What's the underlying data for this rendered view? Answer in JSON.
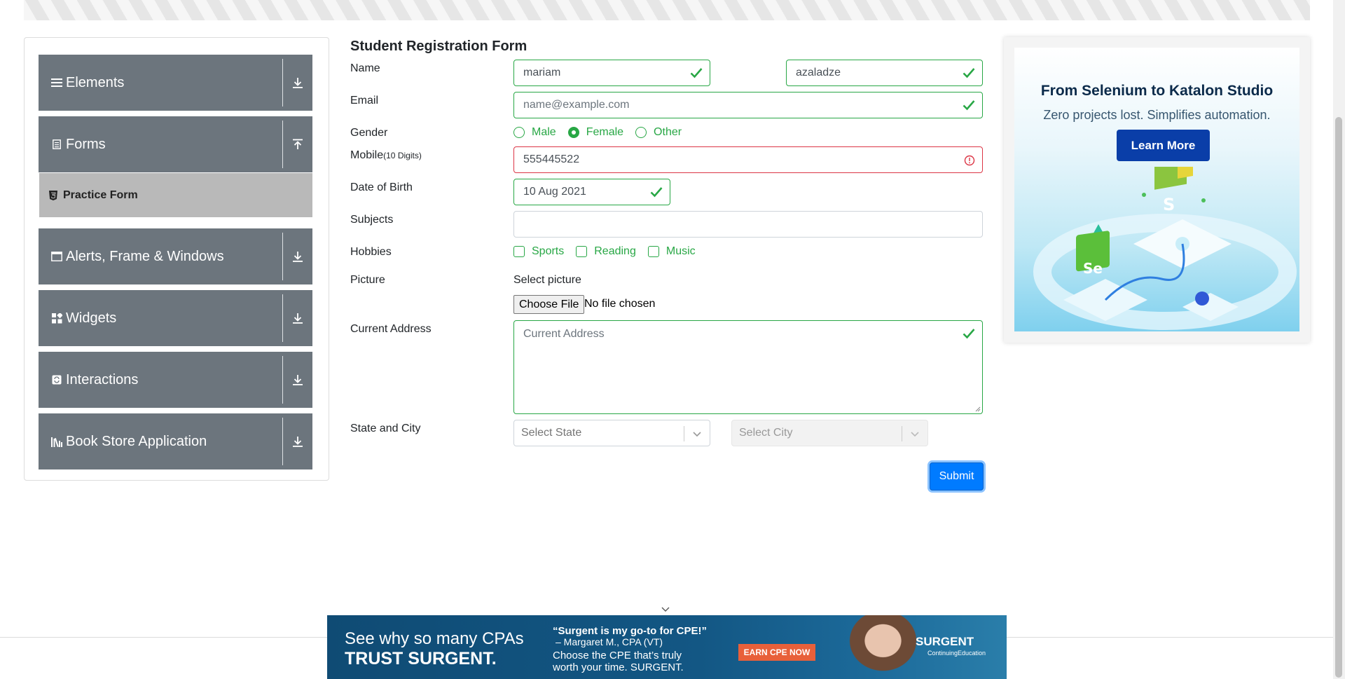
{
  "sidebar": {
    "groups": [
      {
        "label": "Elements",
        "icon": "menu-lines-icon",
        "expanded": false
      },
      {
        "label": "Forms",
        "icon": "document-icon",
        "expanded": true
      },
      {
        "label": "Alerts, Frame & Windows",
        "icon": "window-icon",
        "expanded": false
      },
      {
        "label": "Widgets",
        "icon": "widgets-grid-icon",
        "expanded": false
      },
      {
        "label": "Interactions",
        "icon": "interactions-icon",
        "expanded": false
      },
      {
        "label": "Book Store Application",
        "icon": "books-icon",
        "expanded": false
      }
    ],
    "active_item": "Practice Form"
  },
  "form": {
    "title": "Student Registration Form",
    "name_label": "Name",
    "first_name": "mariam",
    "last_name": "azaladze",
    "email_label": "Email",
    "email_placeholder": "name@example.com",
    "gender_label": "Gender",
    "gender_options": [
      "Male",
      "Female",
      "Other"
    ],
    "gender_selected": "Female",
    "mobile_label": "Mobile",
    "mobile_hint": "(10 Digits)",
    "mobile_value": "555445522",
    "dob_label": "Date of Birth",
    "dob_value": "10 Aug 2021",
    "subjects_label": "Subjects",
    "hobbies_label": "Hobbies",
    "hobbies": [
      "Sports",
      "Reading",
      "Music"
    ],
    "picture_label": "Picture",
    "select_picture": "Select picture",
    "choose_file": "Choose File",
    "no_file": "No file chosen",
    "address_label": "Current Address",
    "address_placeholder": "Current Address",
    "state_city_label": "State and City",
    "state_placeholder": "Select State",
    "city_placeholder": "Select City",
    "submit": "Submit"
  },
  "colors": {
    "valid": "#28a745",
    "invalid": "#dc3545",
    "sidebar_group": "#6c757d",
    "active_item": "#b9b9b9",
    "primary": "#007bff"
  },
  "ad_right": {
    "headline": "From Selenium to Katalon Studio",
    "subline": "Zero projects lost. Simplifies automation.",
    "button": "Learn More",
    "badge_s": "S",
    "badge_se": "Se"
  },
  "ad_bottom": {
    "line1": "See why so many CPAs",
    "line2": "TRUST SURGENT.",
    "quote": "“Surgent is my go-to for CPE!”",
    "quote_author": "– Margaret M., CPA (VT)",
    "body1": "Choose the CPE that’s truly",
    "body2": "worth your time. SURGENT.",
    "cta": "EARN CPE NOW",
    "logo": "SURGENT",
    "logo_sub": "ContinuingEducation"
  }
}
